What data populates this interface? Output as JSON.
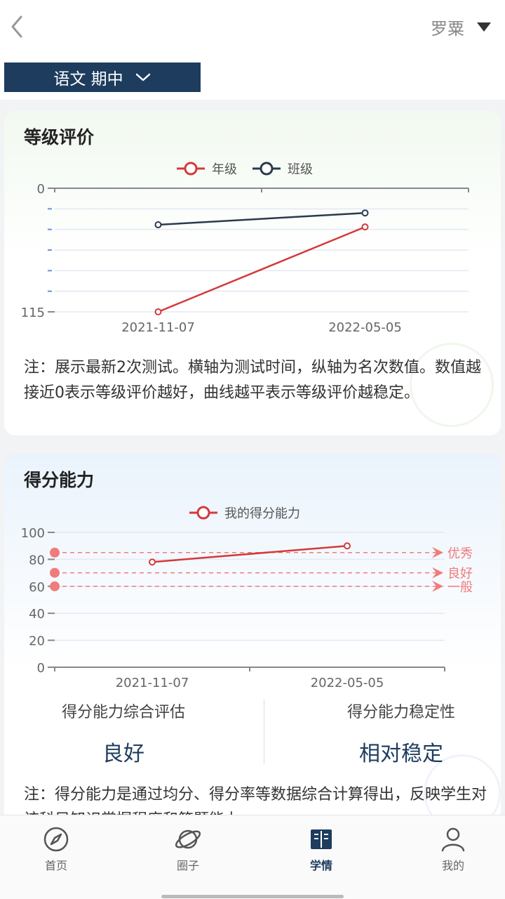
{
  "header": {
    "user_name": "罗粟",
    "back_icon": "chevron-left-icon",
    "dropdown_icon": "caret-down-icon"
  },
  "filter": {
    "label": "语文 期中",
    "icon": "chevron-down-icon"
  },
  "colors": {
    "brand": "#1d3c5e",
    "grade_series": "#d43a3a",
    "class_series": "#2b3a4d",
    "threshold": "#f07b7b"
  },
  "grade_card": {
    "title": "等级评价",
    "note": "注：展示最新2次测试。横轴为测试时间，纵轴为名次数值。数值越接近0表示等级评价越好，曲线越平表示等级评价越稳定。"
  },
  "score_card": {
    "title": "得分能力",
    "overall_label": "得分能力综合评估",
    "overall_value": "良好",
    "stability_label": "得分能力稳定性",
    "stability_value": "相对稳定",
    "note": "注：得分能力是通过均分、得分率等数据综合计算得出，反映学生对该科目知识掌握程度和答题能力。"
  },
  "chart_data": [
    {
      "type": "line",
      "x": [
        "2021-11-07",
        "2022-05-05"
      ],
      "series": [
        {
          "name": "年级",
          "values": [
            115,
            36
          ]
        },
        {
          "name": "班级",
          "values": [
            34,
            23
          ]
        }
      ],
      "yticks": [
        0,
        115
      ],
      "ylim": [
        0,
        115
      ],
      "inverted": true,
      "legend": "top-center",
      "grid": true
    },
    {
      "type": "line",
      "x": [
        "2021-11-07",
        "2022-05-05"
      ],
      "series": [
        {
          "name": "我的得分能力",
          "values": [
            78,
            90
          ]
        }
      ],
      "yticks": [
        0,
        20,
        40,
        60,
        80,
        100
      ],
      "ylim": [
        0,
        100
      ],
      "thresholds": [
        {
          "label": "优秀",
          "value": 85
        },
        {
          "label": "良好",
          "value": 70
        },
        {
          "label": "一般",
          "value": 60
        }
      ],
      "legend": "top-center",
      "grid": true
    }
  ],
  "tabbar": {
    "items": [
      {
        "label": "首页",
        "icon": "compass-icon",
        "active": false
      },
      {
        "label": "圈子",
        "icon": "planet-icon",
        "active": false
      },
      {
        "label": "学情",
        "icon": "book-icon",
        "active": true
      },
      {
        "label": "我的",
        "icon": "person-icon",
        "active": false
      }
    ]
  }
}
